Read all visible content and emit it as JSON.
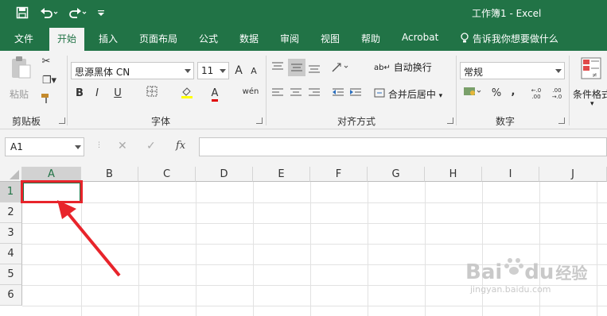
{
  "titlebar": {
    "title": "工作簿1  -  Excel",
    "save_icon": "save-icon",
    "undo_icon": "undo-icon",
    "redo_icon": "redo-icon",
    "customize_icon": "customize-quick-access-icon"
  },
  "tabs": [
    "文件",
    "开始",
    "插入",
    "页面布局",
    "公式",
    "数据",
    "审阅",
    "视图",
    "帮助",
    "Acrobat"
  ],
  "active_tab": "开始",
  "tell_me": "告诉我你想要做什么",
  "ribbon": {
    "clipboard": {
      "paste": "粘贴",
      "label": "剪贴板"
    },
    "font": {
      "name": "思源黑体 CN",
      "size": "11",
      "label": "字体",
      "grow": "A",
      "shrink": "A",
      "bold": "B",
      "italic": "I",
      "underline": "U",
      "font_color": "A",
      "phonetic": "wén"
    },
    "alignment": {
      "wrap": "自动换行",
      "merge": "合并后居中",
      "label": "对齐方式"
    },
    "number": {
      "format": "常规",
      "percent": "%",
      "comma": ",",
      "inc_dec": ".00→.0",
      "label": "数字"
    },
    "styles": {
      "conditional": "条件格式"
    }
  },
  "formula_bar": {
    "name_box": "A1",
    "fx": "fx",
    "value": ""
  },
  "grid": {
    "columns": [
      "A",
      "B",
      "C",
      "D",
      "E",
      "F",
      "G",
      "H",
      "I",
      "J"
    ],
    "rows": [
      "1",
      "2",
      "3",
      "4",
      "5",
      "6"
    ],
    "selected_cell": "A1"
  },
  "watermark": {
    "brand": "Bai",
    "brand2": "du",
    "cn": "经验",
    "url": "jingyan.baidu.com"
  },
  "annotation_color": "#e8242b",
  "accent": "#217346"
}
